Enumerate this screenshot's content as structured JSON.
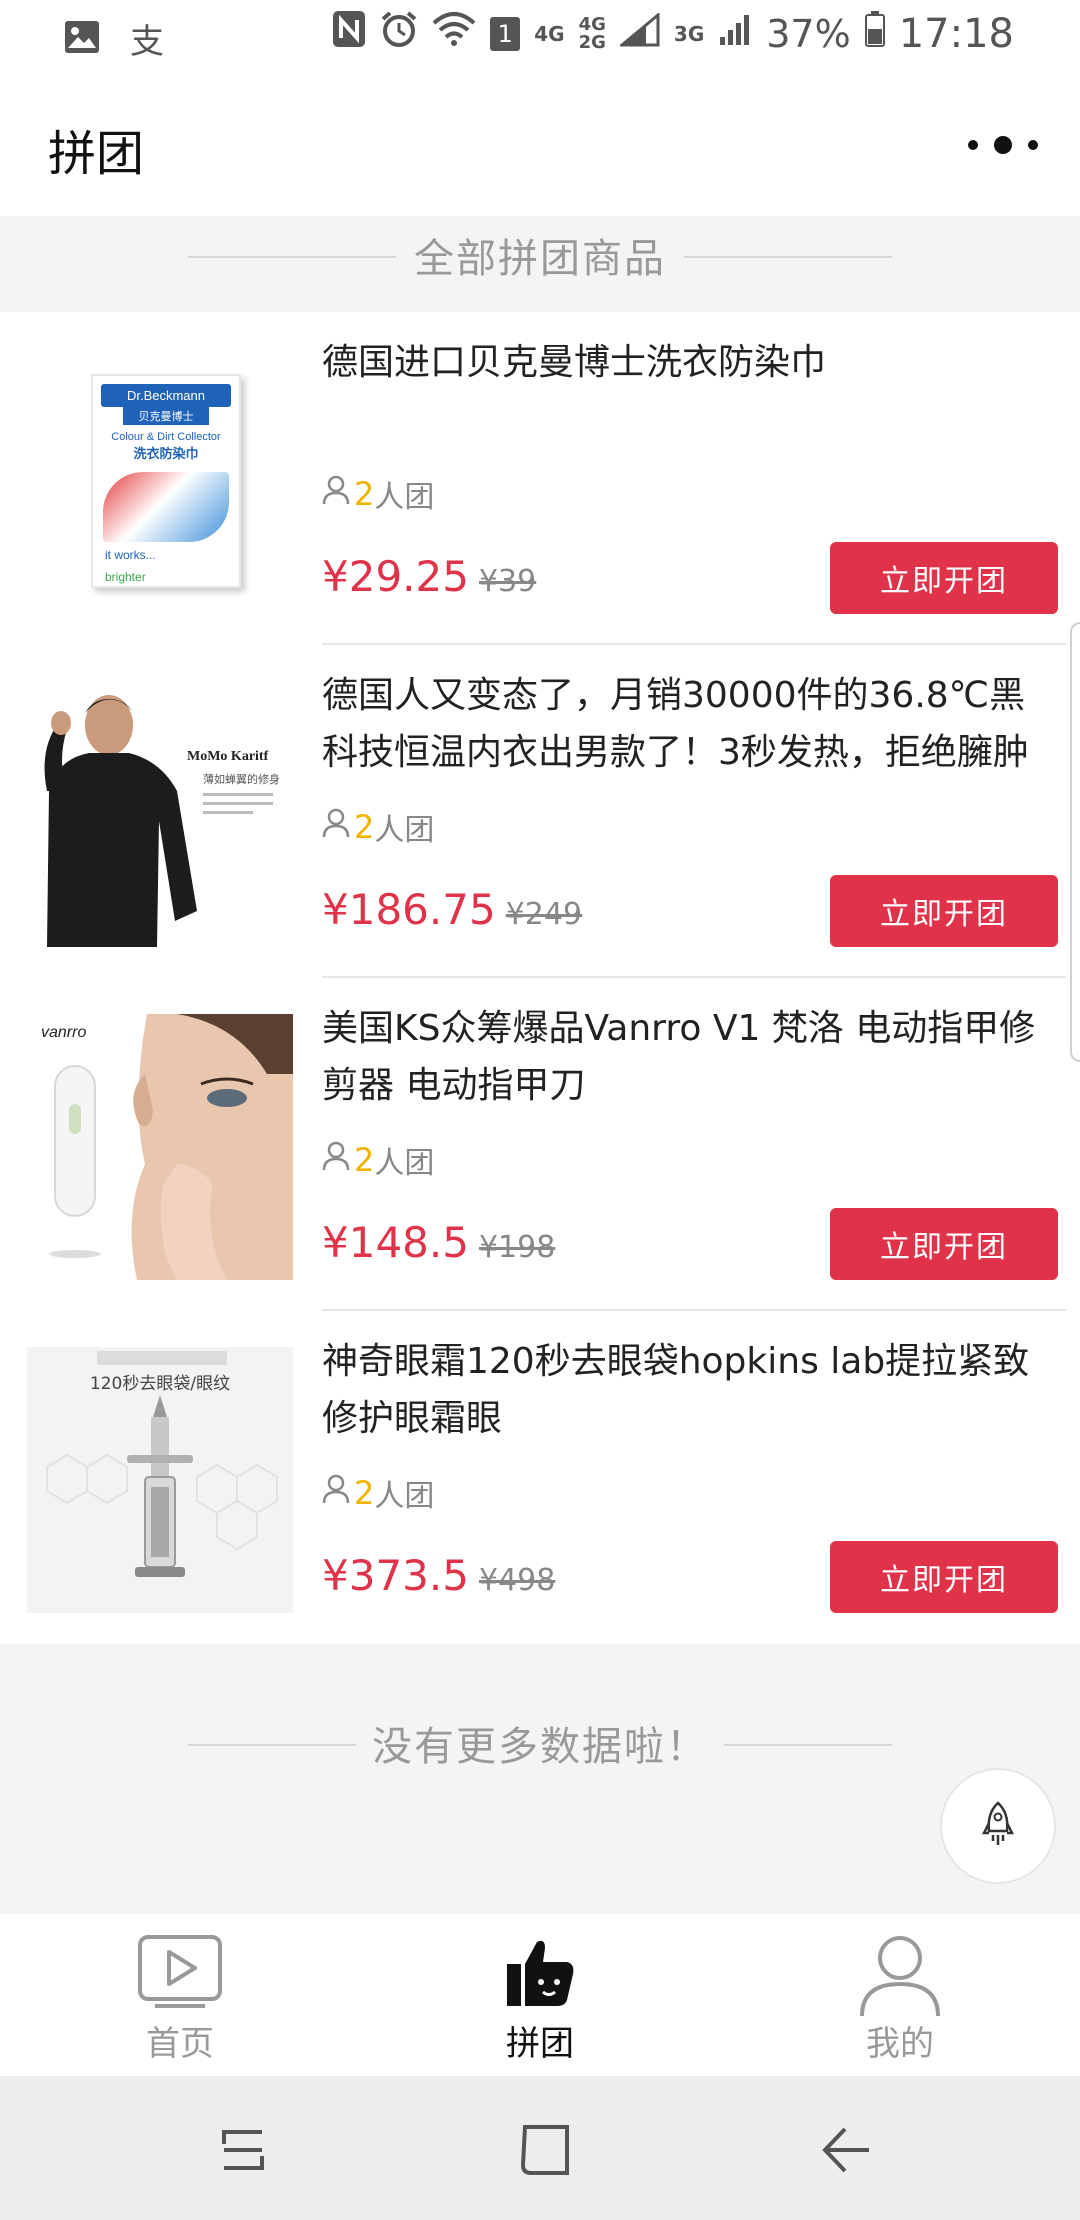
{
  "status_bar": {
    "battery": "37%",
    "time": "17:18",
    "sim_badge": "1",
    "net_4g": "4G",
    "net_4g_2g_top": "4G",
    "net_4g_2g_bottom": "2G",
    "net_3g": "3G",
    "icons": [
      "image-icon",
      "translate-icon",
      "nfc-icon",
      "alarm-icon",
      "wifi-icon",
      "signal-icon",
      "battery-icon"
    ]
  },
  "header": {
    "title": "拼团"
  },
  "section": {
    "title": "全部拼团商品"
  },
  "products": [
    {
      "name": "德国进口贝克曼博士洗衣防染巾",
      "team_size": "2",
      "team_suffix": "人团",
      "price": "¥29.25",
      "original_price": "¥39",
      "button": "立即开团",
      "thumb_brand": "Dr.Beckmann",
      "thumb_cn": "贝克曼博士",
      "thumb_line1": "Colour & Dirt Collector",
      "thumb_line2": "洗衣防染巾",
      "thumb_line3": "it works...",
      "thumb_line4": "brighter"
    },
    {
      "name": "德国人又变态了，月销30000件的36.8℃黑科技恒温内衣出男款了！3秒发热，拒绝臃肿",
      "team_size": "2",
      "team_suffix": "人团",
      "price": "¥186.75",
      "original_price": "¥249",
      "button": "立即开团",
      "thumb_brand": "MoMo Karitf",
      "thumb_cn": "薄如蝉翼的修身"
    },
    {
      "name": "美国KS众筹爆品Vanrro V1 梵洛 电动指甲修剪器 电动指甲刀",
      "team_size": "2",
      "team_suffix": "人团",
      "price": "¥148.5",
      "original_price": "¥198",
      "button": "立即开团",
      "thumb_brand": "vanrro"
    },
    {
      "name": "神奇眼霜120秒去眼袋hopkins lab提拉紧致修护眼霜眼",
      "team_size": "2",
      "team_suffix": "人团",
      "price": "¥373.5",
      "original_price": "¥498",
      "button": "立即开团",
      "thumb_cn": "120秒去眼袋/眼纹"
    }
  ],
  "end_text": "没有更多数据啦！",
  "tabs": [
    {
      "label": "首页",
      "icon": "play-icon",
      "active": false
    },
    {
      "label": "拼团",
      "icon": "thumbs-up-icon",
      "active": true
    },
    {
      "label": "我的",
      "icon": "user-icon",
      "active": false
    }
  ],
  "system_nav": [
    "recent-apps-icon",
    "home-icon",
    "back-icon"
  ],
  "colors": {
    "accent": "#e0334a",
    "team_num": "#f0b400",
    "background": "#f4f4f4"
  }
}
